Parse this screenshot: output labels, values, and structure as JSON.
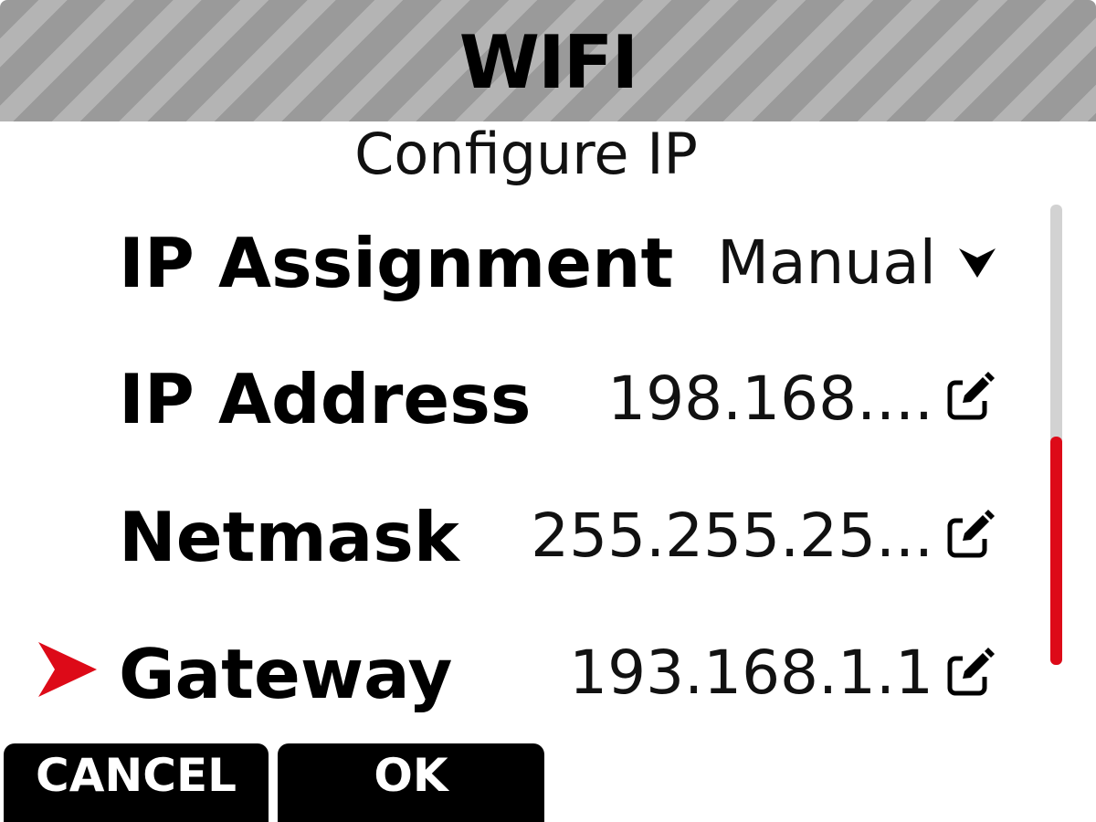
{
  "header": {
    "title": "WIFI"
  },
  "subtitle": "Configure IP",
  "rows": [
    {
      "label": "IP Assignment",
      "value": "Manual",
      "control": "chevron-down-icon"
    },
    {
      "label": "IP Address",
      "value": "198.168....",
      "control": "edit-icon"
    },
    {
      "label": "Netmask",
      "value": "255.255.25...",
      "control": "edit-icon"
    },
    {
      "label": "Gateway",
      "value": "193.168.1.1",
      "control": "edit-icon",
      "selected": true
    }
  ],
  "buttons": {
    "cancel": "CANCEL",
    "ok": "OK"
  },
  "colors": {
    "accent": "#dd0a18",
    "header_stripe_dark": "#9a9a9a",
    "header_stripe_light": "#b4b4b4",
    "scroll_track": "#d2d2d2",
    "button_bg": "#000000"
  },
  "scroll": {
    "position_fraction": 0.5
  }
}
